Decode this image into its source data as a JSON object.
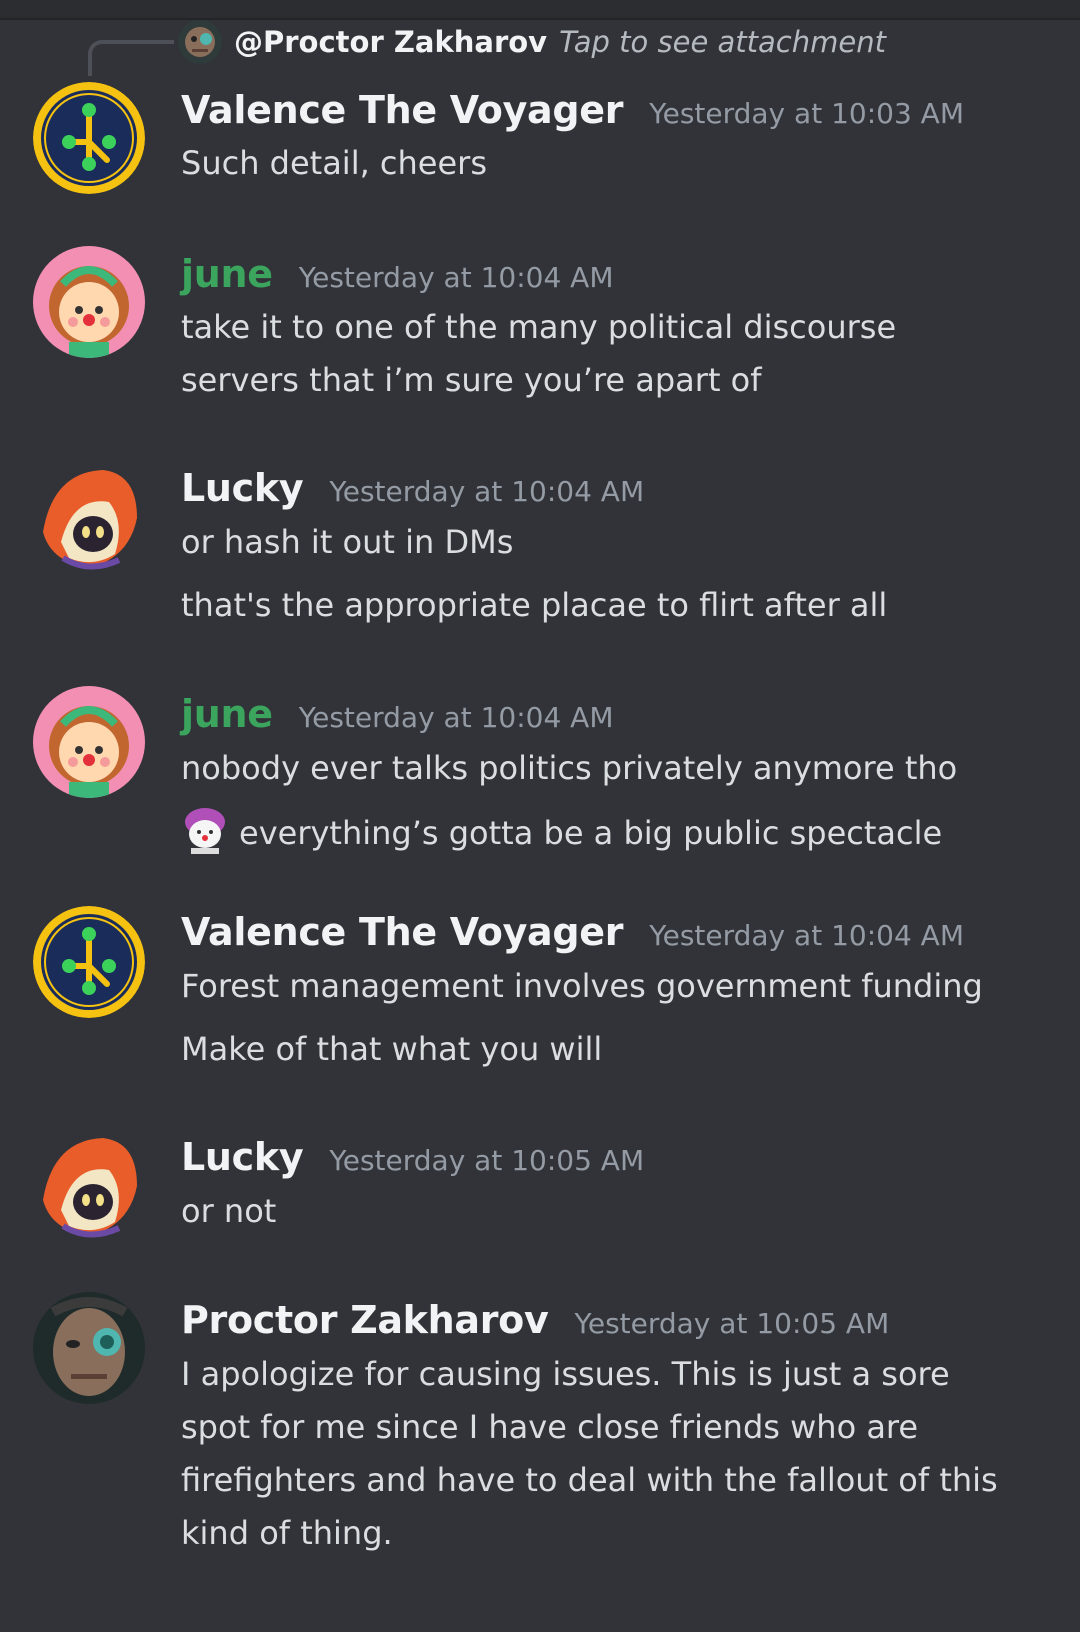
{
  "reply": {
    "author": "@Proctor Zakharov",
    "text": "Tap to see attachment"
  },
  "messages": [
    {
      "author": "Valence The Voyager",
      "time": "Yesterday at 10:03 AM",
      "lines": [
        "Such detail, cheers"
      ]
    },
    {
      "author": "june",
      "time": "Yesterday at 10:04 AM",
      "lines": [
        "take it to one of the many political discourse",
        "servers that i’m sure you’re apart of"
      ]
    },
    {
      "author": "Lucky",
      "time": "Yesterday at 10:04 AM",
      "lines": [
        "or hash it out in DMs",
        "that's the appropriate placae to flirt after all"
      ]
    },
    {
      "author": "june",
      "time": "Yesterday at 10:04 AM",
      "lines": [
        "nobody ever talks politics privately anymore tho",
        "everything’s gotta be a big public spectacle"
      ]
    },
    {
      "author": "Valence The Voyager",
      "time": "Yesterday at 10:04 AM",
      "lines": [
        "Forest management involves government funding",
        "Make of that what you will"
      ]
    },
    {
      "author": "Lucky",
      "time": "Yesterday at 10:05 AM",
      "lines": [
        "or not"
      ]
    },
    {
      "author": "Proctor Zakharov",
      "time": "Yesterday at 10:05 AM",
      "lines": [
        "I apologize for causing issues. This is just a sore",
        "spot for me since I have close friends who are",
        "firefighters and have to deal with the fallout of this",
        "kind of thing."
      ]
    }
  ],
  "colors": {
    "background": "#313338",
    "author_default": "#f2f3f5",
    "author_june": "#3ba55d",
    "timestamp": "#949ba4",
    "message_text": "#dbdee1"
  }
}
